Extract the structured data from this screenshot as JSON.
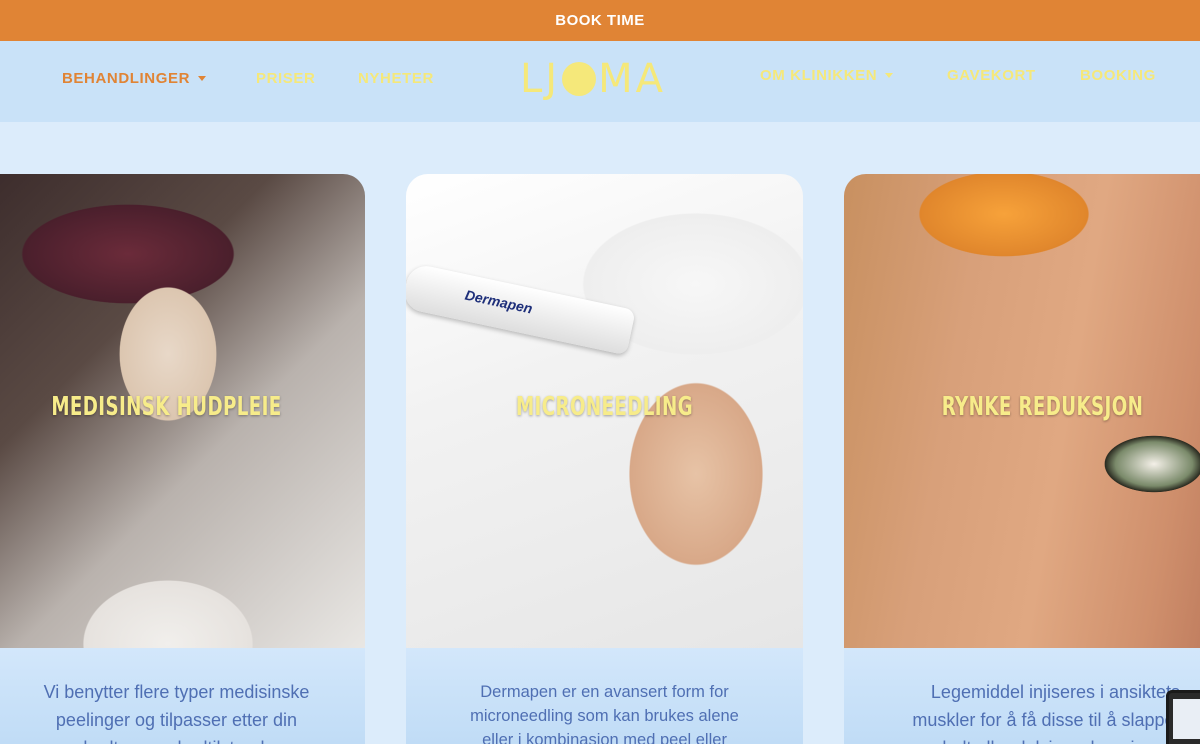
{
  "topbar": {
    "book_label": "BOOK TIME"
  },
  "nav": {
    "left": [
      {
        "label": "BEHANDLINGER",
        "active": true,
        "dropdown": true
      },
      {
        "label": "PRISER",
        "active": false,
        "dropdown": false
      },
      {
        "label": "NYHETER",
        "active": false,
        "dropdown": false
      }
    ],
    "logo": {
      "before": "LJ",
      "after": "MA"
    },
    "right": [
      {
        "label": "OM KLINIKKEN",
        "dropdown": true
      },
      {
        "label": "GAVEKORT",
        "dropdown": false
      },
      {
        "label": "BOOKING",
        "dropdown": false
      }
    ]
  },
  "cards": [
    {
      "title": "MEDISINSK HUDPLEIE",
      "desc_lines": [
        "Vi benytter flere typer medisinske",
        "peelinger og tilpasser etter din",
        "hudtype og hudtilstand."
      ]
    },
    {
      "title": "MICRONEEDLING",
      "pen_brand": "Dermapen",
      "desc_lines": [
        "Dermapen er en avansert form for",
        "microneedling som kan brukes alene",
        "eller i kombinasjon med peel eller"
      ]
    },
    {
      "title": "RYNKE REDUKSJON",
      "desc_lines": [
        "Legemiddel injiseres i ansiktets",
        "muskler for å få disse til å slappe av",
        "helt eller delvis, avhengig av"
      ]
    }
  ],
  "colors": {
    "accent_orange": "#e08435",
    "nav_yellow": "#f5e87a",
    "nav_bg": "#c9e2f8",
    "page_bg": "#dcecfb",
    "body_text": "#4f6fb3"
  }
}
